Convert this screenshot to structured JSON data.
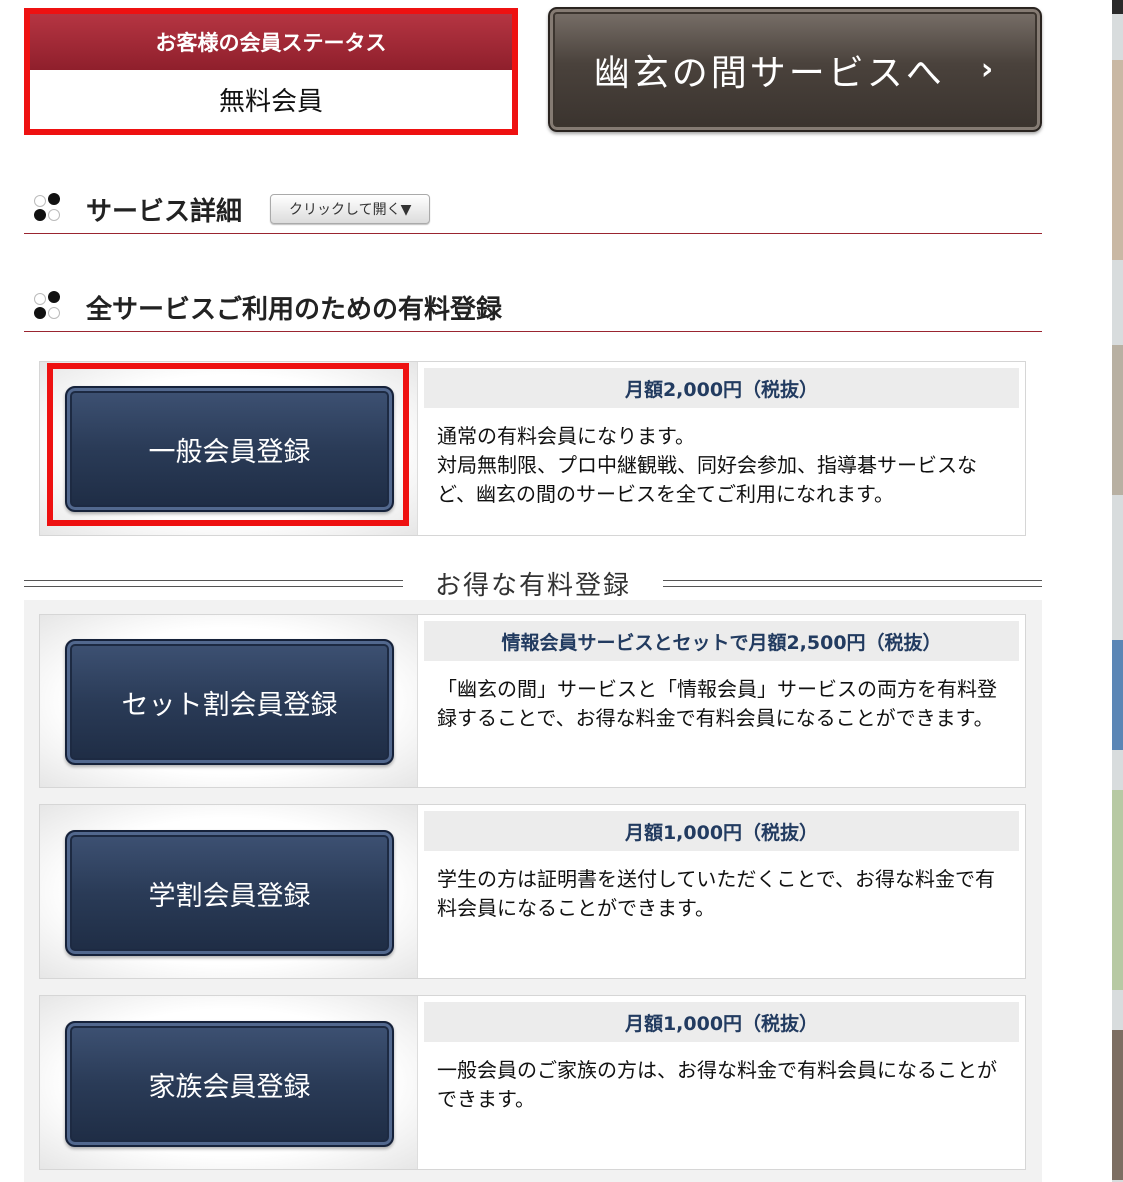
{
  "status": {
    "heading": "お客様の会員ステータス",
    "value": "無料会員"
  },
  "service_button": {
    "label": "幽玄の間サービスへ",
    "chevron": "›"
  },
  "service_details": {
    "title": "サービス詳細",
    "toggle_label": "クリックして開く▼"
  },
  "paid_section": {
    "title": "全サービスご利用のための有料登録"
  },
  "general_plan": {
    "button": "一般会員登録",
    "price": "月額2,000円（税抜）",
    "description": "通常の有料会員になります。\n対局無制限、プロ中継観戦、同好会参加、指導碁サービスなど、幽玄の間のサービスを全てご利用になれます。"
  },
  "discount_divider": "お得な有料登録",
  "plans": [
    {
      "button": "セット割会員登録",
      "price": "情報会員サービスとセットで月額2,500円（税抜）",
      "description": "「幽玄の間」サービスと「情報会員」サービスの両方を有料登録することで、お得な料金で有料会員になることができます。"
    },
    {
      "button": "学割会員登録",
      "price": "月額1,000円（税抜）",
      "description": "学生の方は証明書を送付していただくことで、お得な料金で有料会員になることができます。"
    },
    {
      "button": "家族会員登録",
      "price": "月額1,000円（税抜）",
      "description": "一般会員のご家族の方は、お得な料金で有料会員になることができます。"
    }
  ],
  "colors": {
    "highlight_red": "#ee1111",
    "status_header": "#a02a37",
    "navy_button": "#2a3b57",
    "price_text": "#223b60",
    "section_rule": "#9a2530"
  }
}
